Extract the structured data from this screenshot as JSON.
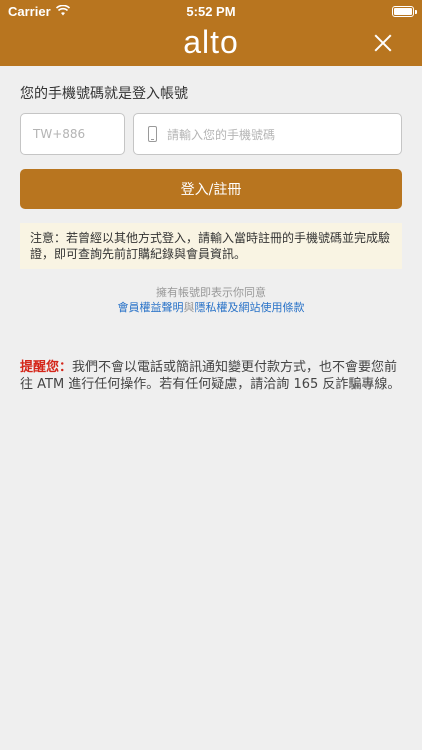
{
  "statusbar": {
    "carrier": "Carrier",
    "time": "5:52 PM"
  },
  "header": {
    "logo": "alto"
  },
  "login": {
    "title": "您的手機號碼就是登入帳號",
    "country_code_placeholder": "TW+886",
    "phone_placeholder": "請輸入您的手機號碼",
    "button_label": "登入/註冊"
  },
  "notice": {
    "text": "注意：若曾經以其他方式登入，請輸入當時註冊的手機號碼並完成驗證，即可查詢先前訂購紀錄與會員資訊。"
  },
  "agreement": {
    "prefix": "擁有帳號即表示你同意",
    "link1": "會員權益聲明",
    "connector": "與",
    "link2": "隱私權及網站使用條款"
  },
  "warning": {
    "label": "提醒您：",
    "text": "我們不會以電話或簡訊通知變更付款方式，也不會要您前往 ATM 進行任何操作。若有任何疑慮，請洽詢 165 反詐騙專線。"
  },
  "colors": {
    "brand": "#b8751f",
    "warning": "#d4261a",
    "link": "#2a73c8",
    "notice_bg": "#f9f4e3"
  }
}
